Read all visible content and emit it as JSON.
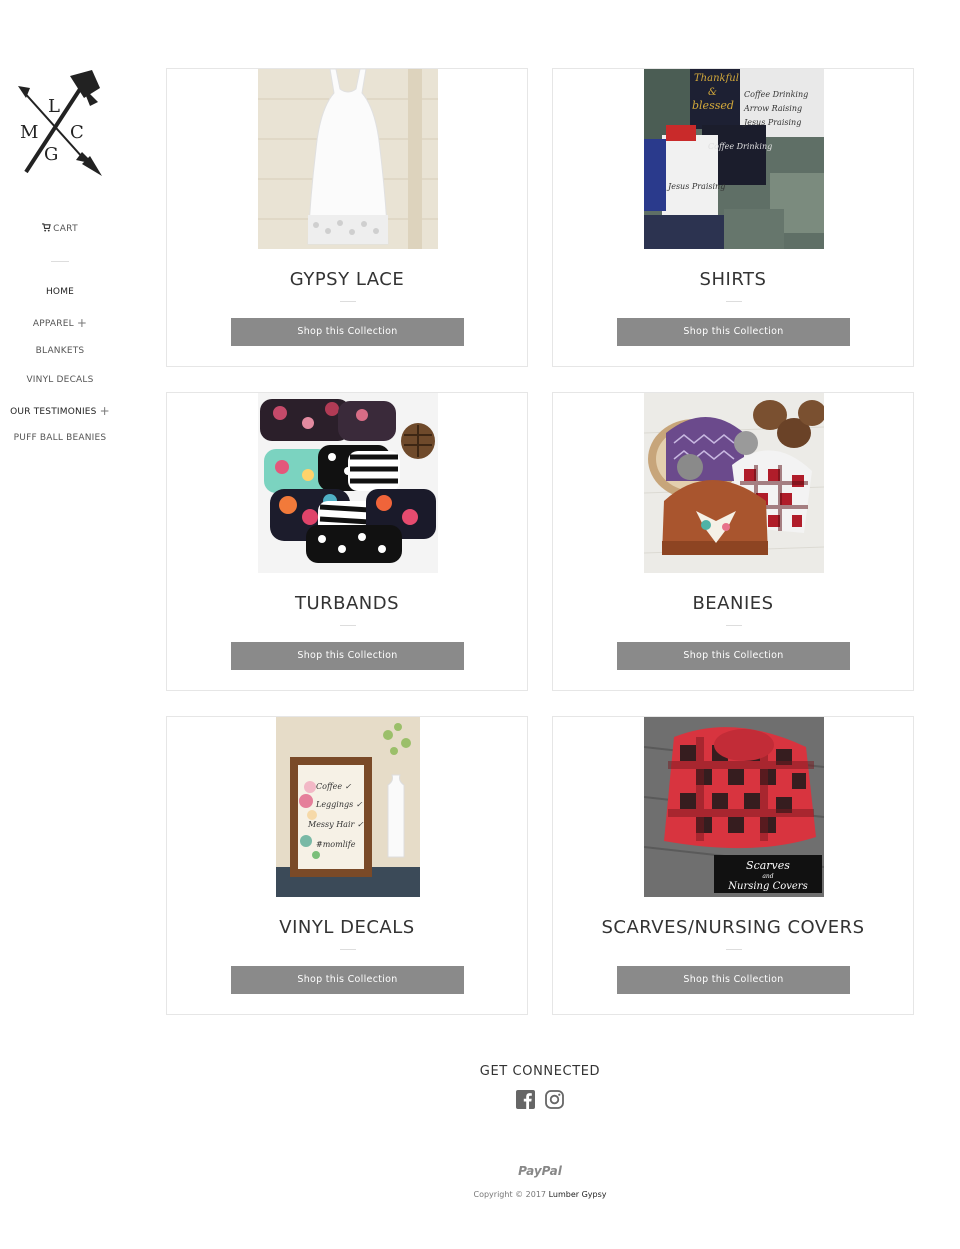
{
  "logo": {
    "letters": [
      "L",
      "M",
      "C",
      "G"
    ]
  },
  "sidebar": {
    "cart_label": "CART",
    "nav": [
      {
        "label": "HOME"
      },
      {
        "label": "APPAREL",
        "plus": "+"
      },
      {
        "label": "BLANKETS"
      },
      {
        "label": "VINYL DECALS"
      },
      {
        "label": "OUR TESTIMONIES",
        "plus": "+"
      },
      {
        "label": "PUFF BALL BEANIES"
      }
    ]
  },
  "collections": [
    {
      "title": "GYPSY LACE",
      "button": "Shop this Collection"
    },
    {
      "title": "SHIRTS",
      "button": "Shop this Collection"
    },
    {
      "title": "TURBANDS",
      "button": "Shop this Collection"
    },
    {
      "title": "BEANIES",
      "button": "Shop this Collection"
    },
    {
      "title": "VINYL DECALS",
      "button": "Shop this Collection"
    },
    {
      "title": "SCARVES/NURSING COVERS",
      "button": "Shop this Collection"
    }
  ],
  "shirt_text": [
    "Thankful",
    "&",
    "blessed",
    "Coffee Drinking",
    "Arrow Raising",
    "Jesus Praising"
  ],
  "decal_text": [
    "Coffee ✓",
    "Leggings ✓",
    "Messy Hair ✓",
    "#momlife"
  ],
  "scarf_text": [
    "Scarves",
    "and",
    "Nursing Covers"
  ],
  "footer": {
    "title": "GET CONNECTED",
    "payment": "PayPal",
    "copyright": "Copyright ©  2017",
    "brand": "Lumber Gypsy"
  },
  "colors": {
    "button_bg": "#8a8a8a",
    "border": "#e6e6e6"
  }
}
